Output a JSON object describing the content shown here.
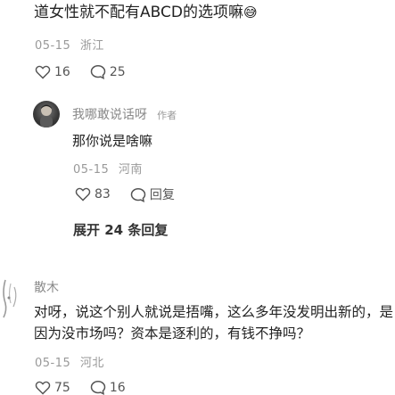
{
  "comment1": {
    "text_line_partial": "...",
    "text_line2": "道女性就不配有ABCD的选项嘛",
    "emoji": "😅",
    "date": "05-15",
    "location": "浙江",
    "likes": "16",
    "replies": "25"
  },
  "reply1": {
    "username": "我哪敢说话呀",
    "badge": "作者",
    "text": "那你说是啥嘛",
    "date": "05-15",
    "location": "河南",
    "likes": "83",
    "reply_label": "回复"
  },
  "expand": {
    "label": "展开 24 条回复"
  },
  "comment2": {
    "username": "散木",
    "text": "对呀，说这个别人就说是捂嘴，这么多年没发明出新的，是因为没市场吗？资本是逐利的，有钱不挣吗？",
    "date": "05-15",
    "location": "河北",
    "likes": "75",
    "replies": "16"
  }
}
